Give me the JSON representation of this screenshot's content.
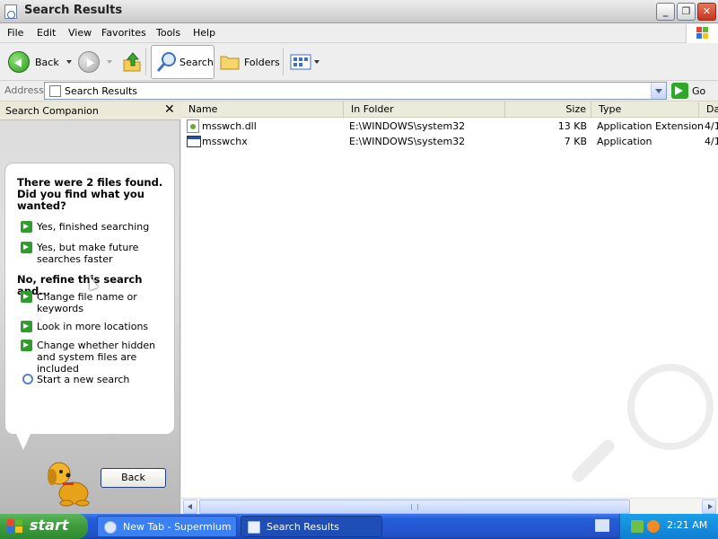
{
  "window": {
    "title": "Search Results",
    "controls": {
      "minimize": "_",
      "maximize": "❐",
      "close": "✕"
    }
  },
  "menubar": {
    "items": [
      "File",
      "Edit",
      "View",
      "Favorites",
      "Tools",
      "Help"
    ]
  },
  "toolbar": {
    "back_label": "Back",
    "search_label": "Search",
    "folders_label": "Folders"
  },
  "address": {
    "label": "Address",
    "value": "Search Results",
    "go_label": "Go"
  },
  "companion": {
    "header": "Search Companion",
    "close_glyph": "✕",
    "found_message": "There were 2 files found. Did you find what you wanted?",
    "options": [
      "Yes, finished searching",
      "Yes, but make future searches faster"
    ],
    "refine_heading": "No, refine this search and...",
    "refine_options": [
      "Change file name or keywords",
      "Look in more locations",
      "Change whether hidden and system files are included"
    ],
    "new_search": "Start a new search",
    "back_button": "Back"
  },
  "filelist": {
    "columns": [
      "Name",
      "In Folder",
      "Size",
      "Type",
      "Da"
    ],
    "rows": [
      {
        "name": "msswch.dll",
        "folder": "E:\\WINDOWS\\system32",
        "size": "13 KB",
        "type": "Application Extension",
        "date": "4/1"
      },
      {
        "name": "msswchx",
        "folder": "E:\\WINDOWS\\system32",
        "size": "7 KB",
        "type": "Application",
        "date": "4/1"
      }
    ]
  },
  "taskbar": {
    "start_label": "start",
    "tasks": [
      "New Tab - Supermium",
      "Search Results"
    ],
    "clock": "2:21 AM"
  },
  "colors": {
    "taskbar_blue": "#245edb",
    "start_green": "#3c9a3c",
    "tray_blue": "#0f7ed4",
    "arrow_green": "#2e9d2a"
  }
}
